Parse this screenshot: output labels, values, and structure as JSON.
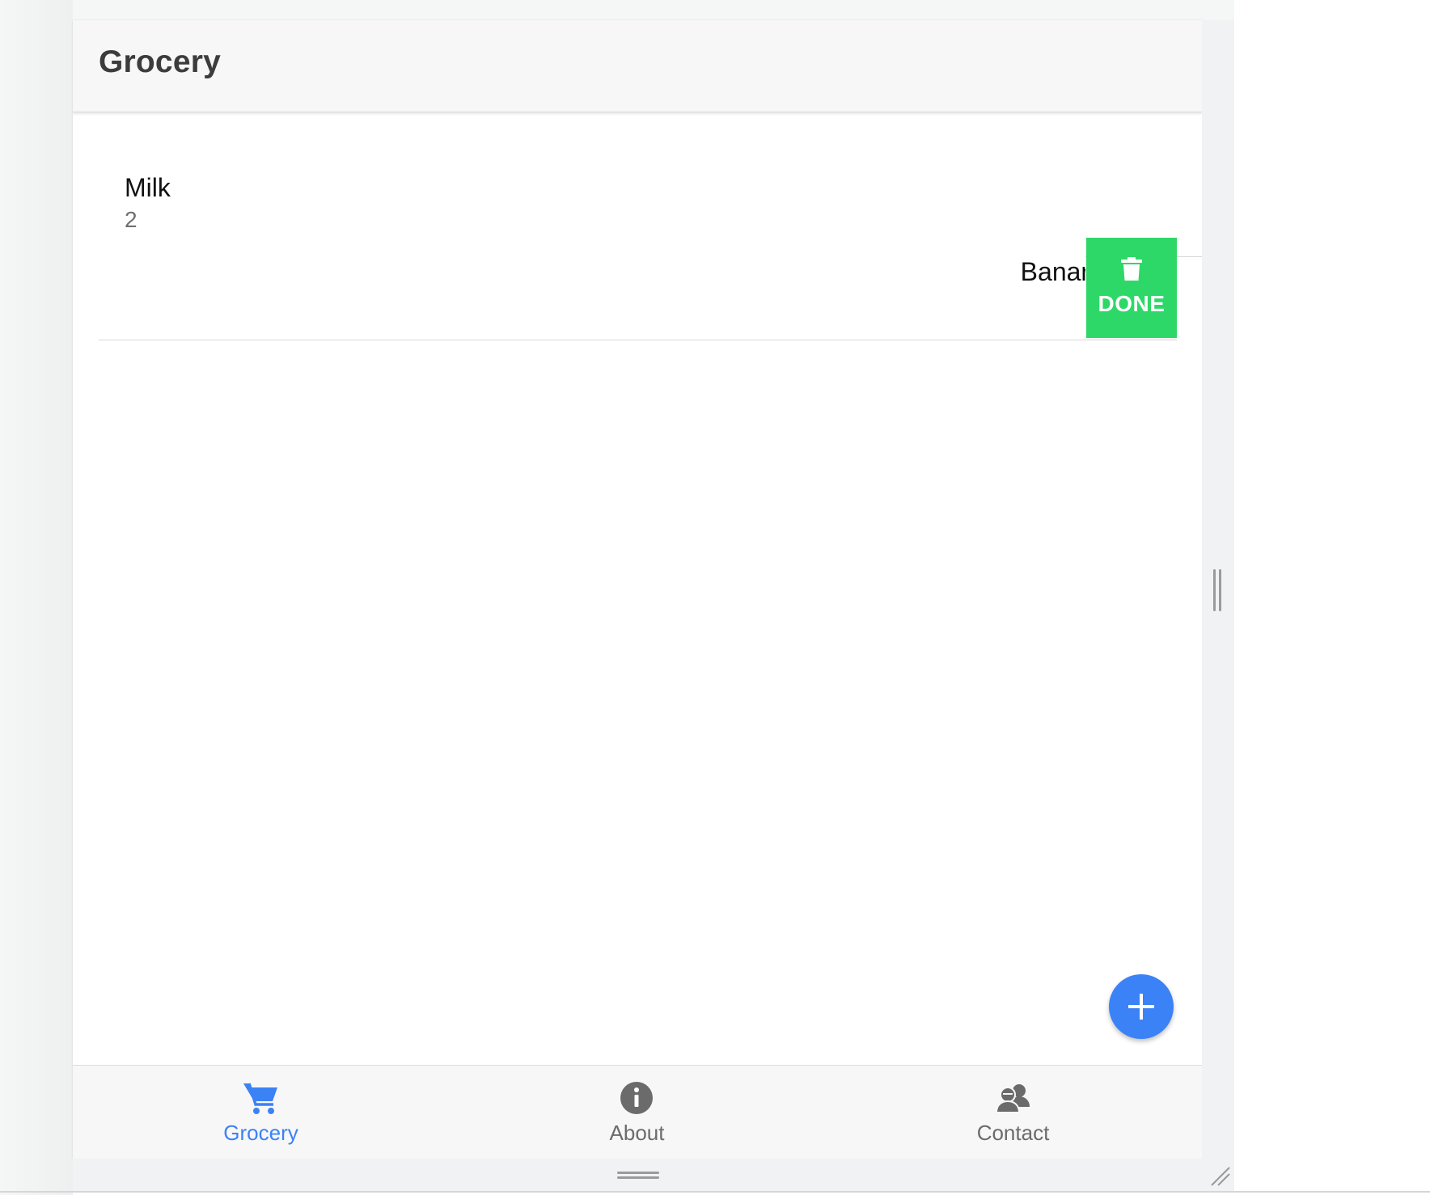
{
  "app": {
    "title": "Grocery"
  },
  "items": [
    {
      "name": "Milk",
      "quantity": "2"
    },
    {
      "name": "Banana"
    }
  ],
  "swipe_action": {
    "label": "DONE",
    "icon": "trash-icon",
    "color": "#2ed868"
  },
  "fab": {
    "icon": "plus-icon",
    "color": "#3b82f6"
  },
  "tabs": [
    {
      "label": "Grocery",
      "icon": "cart-icon",
      "active": true
    },
    {
      "label": "About",
      "icon": "info-icon",
      "active": false
    },
    {
      "label": "Contact",
      "icon": "people-icon",
      "active": false
    }
  ],
  "colors": {
    "active_tab": "#3b82f6",
    "inactive_tab": "#6b6b6b"
  }
}
